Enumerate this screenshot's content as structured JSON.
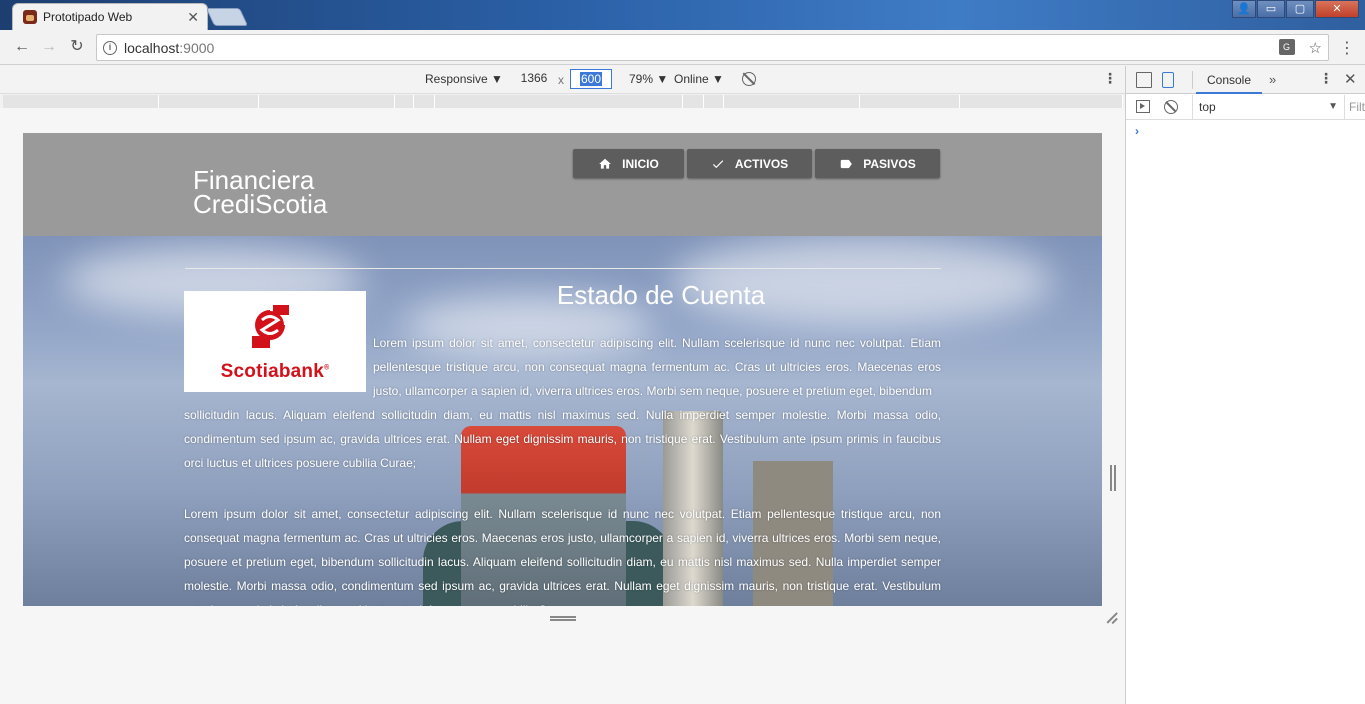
{
  "browser": {
    "tab_title": "Prototipado Web",
    "tab_close": "✕",
    "url_host": "localhost",
    "url_port": ":9000",
    "window_buttons": {
      "minimize": "▭",
      "maximize": "▢",
      "close": "✕",
      "user": "👤"
    }
  },
  "device_toolbar": {
    "mode": "Responsive ▼",
    "width": "1366",
    "times": "x",
    "height": "600",
    "zoom": "79% ▼",
    "network": "Online ▼",
    "more": "⋮"
  },
  "site": {
    "brand_line1": "Financiera",
    "brand_line2": "CrediScotia",
    "nav": [
      {
        "label": "INICIO",
        "icon": "home-icon"
      },
      {
        "label": "ACTIVOS",
        "icon": "check-icon"
      },
      {
        "label": "PASIVOS",
        "icon": "label-icon"
      }
    ],
    "logo_text": "Scotiabank",
    "title": "Estado de Cuenta",
    "paragraph1_part1": "Lorem ipsum dolor sit amet, consectetur adipiscing elit. Nullam scelerisque id nunc nec volutpat. Etiam pellentesque tristique arcu, non consequat magna fermentum ac. Cras ut ultricies eros. Maecenas eros justo, ullamcorper a sapien id, viverra ultrices eros. Morbi sem neque, posuere et pretium eget, bibendum",
    "paragraph1_part2": "sollicitudin lacus. Aliquam eleifend sollicitudin diam, eu mattis nisl maximus sed. Nulla imperdiet semper molestie. Morbi massa odio, condimentum sed ipsum ac, gravida ultrices erat. Nullam eget dignissim mauris, non tristique erat. Vestibulum ante ipsum primis in faucibus orci luctus et ultrices posuere cubilia Curae;",
    "paragraph2": "Lorem ipsum dolor sit amet, consectetur adipiscing elit. Nullam scelerisque id nunc nec volutpat. Etiam pellentesque tristique arcu, non consequat magna fermentum ac. Cras ut ultricies eros. Maecenas eros justo, ullamcorper a sapien id, viverra ultrices eros. Morbi sem neque, posuere et pretium eget, bibendum sollicitudin lacus. Aliquam eleifend sollicitudin diam, eu mattis nisl maximus sed. Nulla imperdiet semper molestie. Morbi massa odio, condimentum sed ipsum ac, gravida ultrices erat. Nullam eget dignissim mauris, non tristique erat. Vestibulum ante ipsum primis in faucibus orci luctus et ultrices posuere cubilia Curae;"
  },
  "devtools": {
    "console_tab": "Console",
    "more_tabs": "»",
    "menu": "⋮",
    "close": "✕",
    "context": "top",
    "context_arrow": "▼",
    "filter_placeholder": "Filter",
    "prompt": "›"
  },
  "colors": {
    "brand_red": "#d3111a",
    "nav_button": "#5d5d5d",
    "header_gray": "#9a9a9a",
    "devtools_accent": "#3b78d8"
  }
}
